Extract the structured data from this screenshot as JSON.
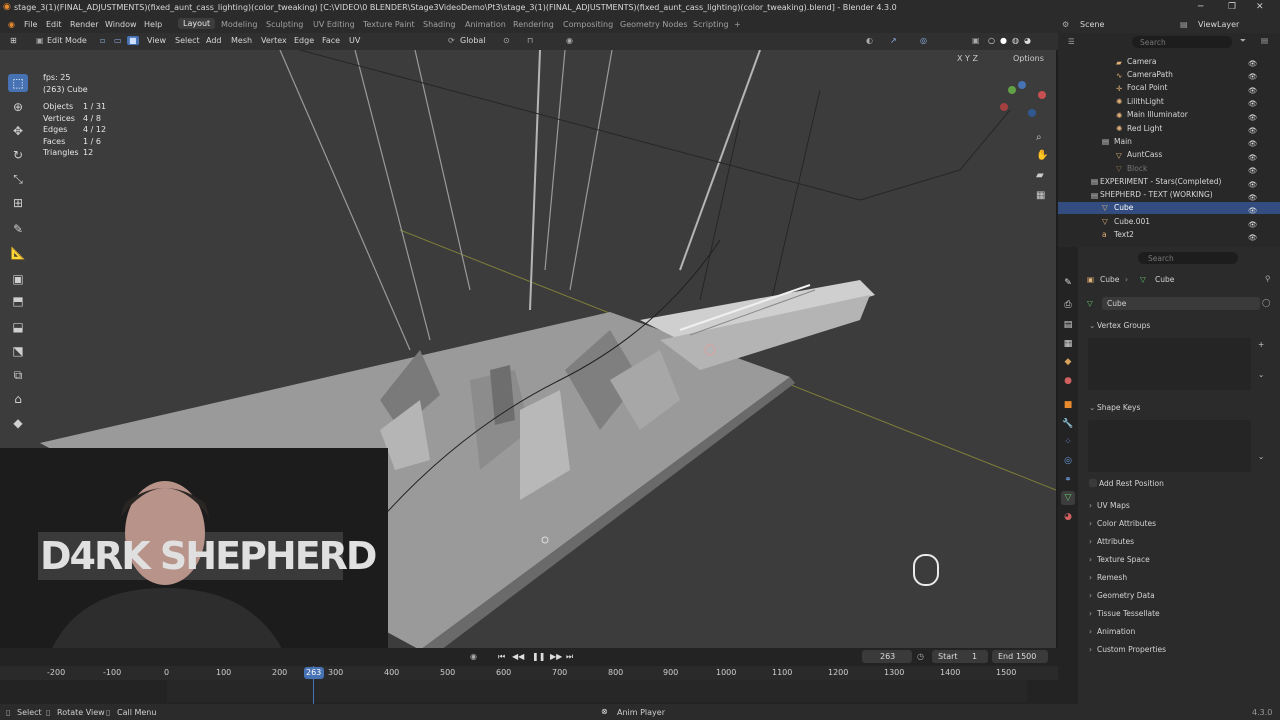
{
  "title_bar": {
    "text": "stage_3(1)(FINAL_ADJUSTMENTS)(fixed_aunt_cass_lighting)(color_tweaking) [C:\\VIDEO\\0 BLENDER\\Stage3VideoDemo\\Pt3\\stage_3(1)(FINAL_ADJUSTMENTS)(fixed_aunt_cass_lighting)(color_tweaking).blend] - Blender 4.3.0",
    "minimize": "─",
    "maximize": "❐",
    "close": "✕"
  },
  "menu": {
    "file": "File",
    "edit": "Edit",
    "render": "Render",
    "window": "Window",
    "help": "Help"
  },
  "workspaces": [
    "Layout",
    "Modeling",
    "Sculpting",
    "UV Editing",
    "Texture Paint",
    "Shading",
    "Animation",
    "Rendering",
    "Compositing",
    "Geometry Nodes",
    "Scripting",
    "+"
  ],
  "scene": {
    "label": "Scene",
    "view_layer": "ViewLayer"
  },
  "header": {
    "mode": "Edit Mode",
    "view": "View",
    "select": "Select",
    "add": "Add",
    "mesh": "Mesh",
    "vertex": "Vertex",
    "edge": "Edge",
    "face": "Face",
    "uv": "UV",
    "orientation": "Global",
    "options": "Options",
    "axes": "X Y Z"
  },
  "stats": {
    "fps": "fps: 25",
    "object": "(263) Cube",
    "rows": [
      {
        "k": "Objects",
        "v": "1 / 31"
      },
      {
        "k": "Vertices",
        "v": "4 / 8"
      },
      {
        "k": "Edges",
        "v": "4 / 12"
      },
      {
        "k": "Faces",
        "v": "1 / 6"
      },
      {
        "k": "Triangles",
        "v": "12"
      }
    ]
  },
  "webcam": {
    "overlay_text": "D4RK SHEPHERD"
  },
  "outliner": {
    "search_placeholder": "Search",
    "items": [
      {
        "name": "Camera"
      },
      {
        "name": "CameraPath"
      },
      {
        "name": "Focal Point"
      },
      {
        "name": "LilithLight"
      },
      {
        "name": "Main Illuminator"
      },
      {
        "name": "Red Light"
      },
      {
        "name": "Main"
      },
      {
        "name": "AuntCass"
      },
      {
        "name": "Block"
      },
      {
        "name": "EXPERIMENT - Stars(Completed)"
      },
      {
        "name": "SHEPHERD - TEXT (WORKING)"
      },
      {
        "name": "Cube"
      },
      {
        "name": "Cube.001"
      },
      {
        "name": "Text2"
      }
    ]
  },
  "properties": {
    "search_placeholder": "Search",
    "breadcrumb_object": "Cube",
    "breadcrumb_mesh": "Cube",
    "mesh_name": "Cube",
    "vertex_groups": "Vertex Groups",
    "shape_keys": "Shape Keys",
    "add_rest_position": "Add Rest Position",
    "panels": [
      "UV Maps",
      "Color Attributes",
      "Attributes",
      "Texture Space",
      "Remesh",
      "Geometry Data",
      "Tissue Tessellate",
      "Animation",
      "Custom Properties"
    ]
  },
  "timeline": {
    "current_frame": "263",
    "start_label": "Start",
    "start": "1",
    "end_label": "End",
    "end": "1500",
    "ticks": [
      "-200",
      "-100",
      "0",
      "100",
      "200",
      "300",
      "400",
      "500",
      "600",
      "700",
      "800",
      "900",
      "1000",
      "1100",
      "1200",
      "1300",
      "1400",
      "1500"
    ],
    "playhead_label": "263"
  },
  "status": {
    "select": "Select",
    "rotate_view": "Rotate View",
    "call_menu": "Call Menu",
    "anim_player": "Anim Player",
    "version": "4.3.0"
  }
}
